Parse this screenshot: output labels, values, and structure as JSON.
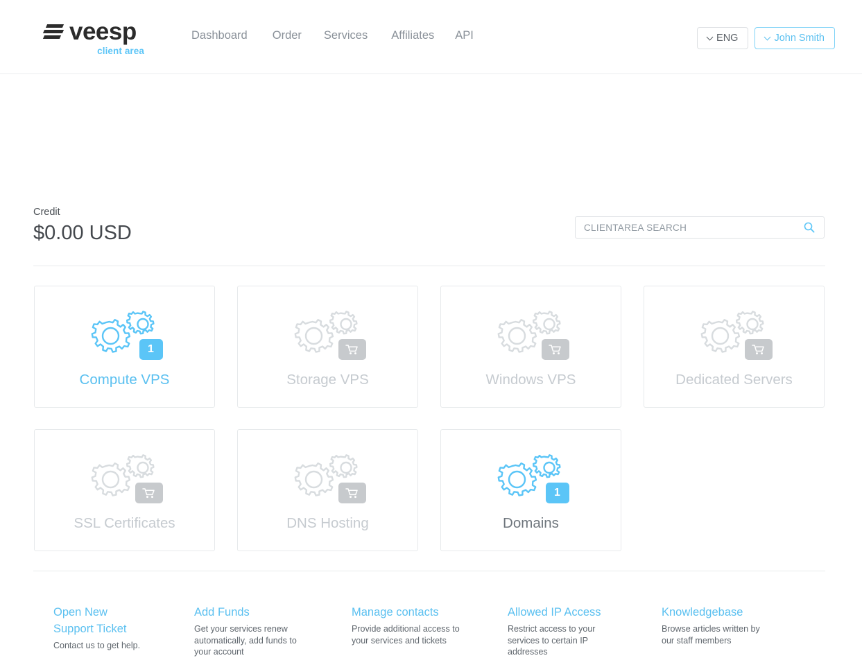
{
  "header": {
    "logo_text": "veesp",
    "logo_sub": "client area",
    "nav": [
      {
        "label": "Dashboard"
      },
      {
        "label": "Order"
      },
      {
        "label": "Services"
      },
      {
        "label": "Affiliates"
      },
      {
        "label": "API"
      }
    ],
    "language_button": "ENG",
    "user_button": "John Smith"
  },
  "account": {
    "credit_label": "Credit",
    "credit_value": "$0.00 USD"
  },
  "search": {
    "placeholder": "CLIENTAREA SEARCH",
    "value": "",
    "icon": "search-icon"
  },
  "cards": [
    {
      "label": "Compute VPS",
      "badge": "1",
      "badge_type": "num",
      "icon": "gears-icon",
      "state": "active",
      "label_style": "blue"
    },
    {
      "label": "Storage VPS",
      "badge": "cart",
      "badge_type": "cart",
      "icon": "gears-icon",
      "state": "inactive",
      "label_style": "grey"
    },
    {
      "label": "Windows VPS",
      "badge": "cart",
      "badge_type": "cart",
      "icon": "gears-icon",
      "state": "inactive",
      "label_style": "grey"
    },
    {
      "label": "Dedicated Servers",
      "badge": "cart",
      "badge_type": "cart",
      "icon": "gears-icon",
      "state": "inactive",
      "label_style": "grey"
    },
    {
      "label": "SSL Certificates",
      "badge": "cart",
      "badge_type": "cart",
      "icon": "gears-icon",
      "state": "inactive",
      "label_style": "grey"
    },
    {
      "label": "DNS Hosting",
      "badge": "cart",
      "badge_type": "cart",
      "icon": "gears-icon",
      "state": "inactive",
      "label_style": "grey"
    },
    {
      "label": "Domains",
      "badge": "1",
      "badge_type": "num",
      "icon": "gears-icon",
      "state": "active",
      "label_style": "dark"
    }
  ],
  "footer": [
    {
      "link": "Open New Support Ticket",
      "desc": "Contact us to get help."
    },
    {
      "link": "Add Funds",
      "desc": "Get your services renew automatically, add funds to your account"
    },
    {
      "link": "Manage contacts",
      "desc": "Provide additional access to your services and tickets"
    },
    {
      "link": "Allowed IP Access",
      "desc": "Restrict access to your services to certain IP addresses"
    },
    {
      "link": "Knowledgebase",
      "desc": "Browse articles written by our staff members"
    }
  ],
  "colors": {
    "accent_blue": "#5bc5f7",
    "link_blue": "#5bc0f0",
    "muted_grey": "#c6cbd0",
    "badge_grey": "#c7cacd",
    "border": "#e6e9eb",
    "text_dark": "#44484d"
  }
}
